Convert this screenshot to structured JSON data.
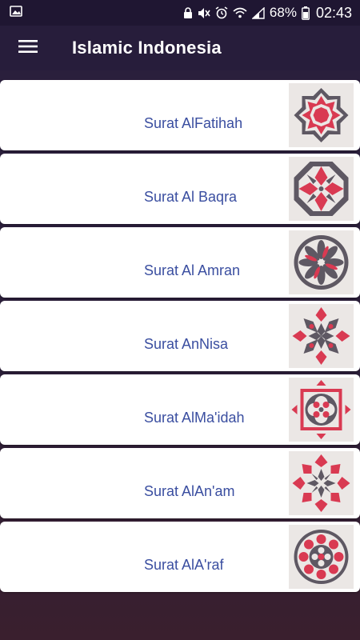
{
  "status_bar": {
    "battery": "68%",
    "time": "02:43"
  },
  "app_bar": {
    "title": "Islamic Indonesia",
    "menu_icon": "hamburger-menu-icon"
  },
  "colors": {
    "app_bar": "#271d3b",
    "label": "#3a4ea0",
    "ornament_red": "#d93a52",
    "ornament_gray": "#5e5863",
    "thumb_bg": "#ebe7e5"
  },
  "surahs": [
    {
      "label": "Surat AlFatihah",
      "icon": "geometric-ornament-icon"
    },
    {
      "label": "Surat Al Baqra",
      "icon": "geometric-ornament-icon"
    },
    {
      "label": "Surat Al Amran",
      "icon": "geometric-ornament-icon"
    },
    {
      "label": "Surat AnNisa",
      "icon": "geometric-ornament-icon"
    },
    {
      "label": "Surat AlMa'idah",
      "icon": "geometric-ornament-icon"
    },
    {
      "label": "Surat AlAn'am",
      "icon": "geometric-ornament-icon"
    },
    {
      "label": "Surat AlA'raf",
      "icon": "geometric-ornament-icon"
    }
  ]
}
